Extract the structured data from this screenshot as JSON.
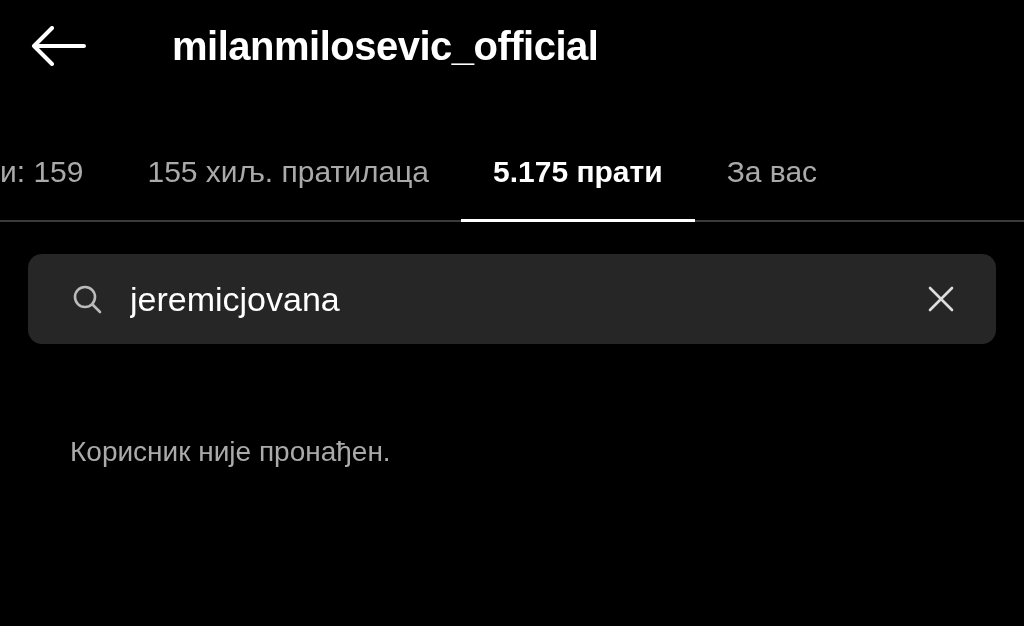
{
  "header": {
    "title": "milanmilosevic_official"
  },
  "tabs": [
    {
      "label": "и: 159",
      "selected": false
    },
    {
      "label": "155 хиљ. пратилаца",
      "selected": false
    },
    {
      "label": "5.175 прати",
      "selected": true
    },
    {
      "label": "За вас",
      "selected": false
    }
  ],
  "search": {
    "value": "jeremicjovana"
  },
  "message": "Корисник није пронађен."
}
